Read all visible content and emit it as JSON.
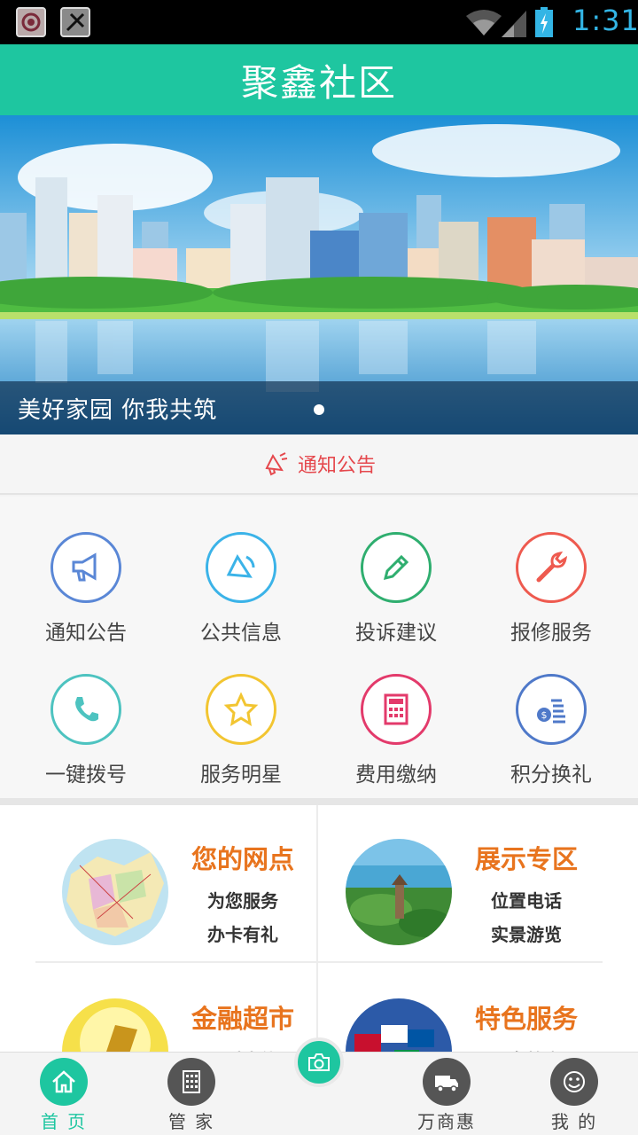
{
  "status_bar": {
    "time": "1:31",
    "icons": [
      "app-flower-icon",
      "app-tool-icon",
      "wifi-icon",
      "signal-icon",
      "battery-charging-icon"
    ]
  },
  "header": {
    "title": "聚鑫社区"
  },
  "banner": {
    "caption": "美好家园  你我共筑",
    "slide_count": 1,
    "active_slide": 0
  },
  "notice": {
    "label": "通知公告",
    "icon": "speaker-icon"
  },
  "grid": [
    {
      "label": "通知公告",
      "icon": "megaphone-icon",
      "color": "#5a87d6"
    },
    {
      "label": "公共信息",
      "icon": "speaker-icon",
      "color": "#3bb3e8"
    },
    {
      "label": "投诉建议",
      "icon": "pencil-icon",
      "color": "#2fae6f"
    },
    {
      "label": "报修服务",
      "icon": "wrench-icon",
      "color": "#ee5a4f"
    },
    {
      "label": "一键拨号",
      "icon": "phone-icon",
      "color": "#4dc3c0"
    },
    {
      "label": "服务明星",
      "icon": "star-icon",
      "color": "#f2c531"
    },
    {
      "label": "费用缴纳",
      "icon": "calculator-icon",
      "color": "#e33a6b"
    },
    {
      "label": "积分换礼",
      "icon": "coins-icon",
      "color": "#4f79c9"
    }
  ],
  "cards": [
    {
      "title": "您的网点",
      "line1": "为您服务",
      "line2": "办卡有礼",
      "image": "map-image"
    },
    {
      "title": "展示专区",
      "line1": "位置电话",
      "line2": "实景游览",
      "image": "scenic-image"
    },
    {
      "title": "金融超市",
      "line1": "理财大礼",
      "line2": "",
      "image": "gold-image"
    },
    {
      "title": "特色服务",
      "line1": "子女教育",
      "line2": "",
      "image": "flags-image"
    }
  ],
  "colors": {
    "accent": "#1ec6a0",
    "card_title": "#e8741e",
    "notice": "#e5484d"
  },
  "bottom_nav": [
    {
      "label": "首 页",
      "icon": "home-icon",
      "active": true
    },
    {
      "label": "管 家",
      "icon": "building-icon",
      "active": false
    },
    {
      "label": "万商惠",
      "icon": "truck-icon",
      "active": false
    },
    {
      "label": "我 的",
      "icon": "smiley-icon",
      "active": false
    }
  ],
  "camera": {
    "icon": "camera-icon"
  }
}
